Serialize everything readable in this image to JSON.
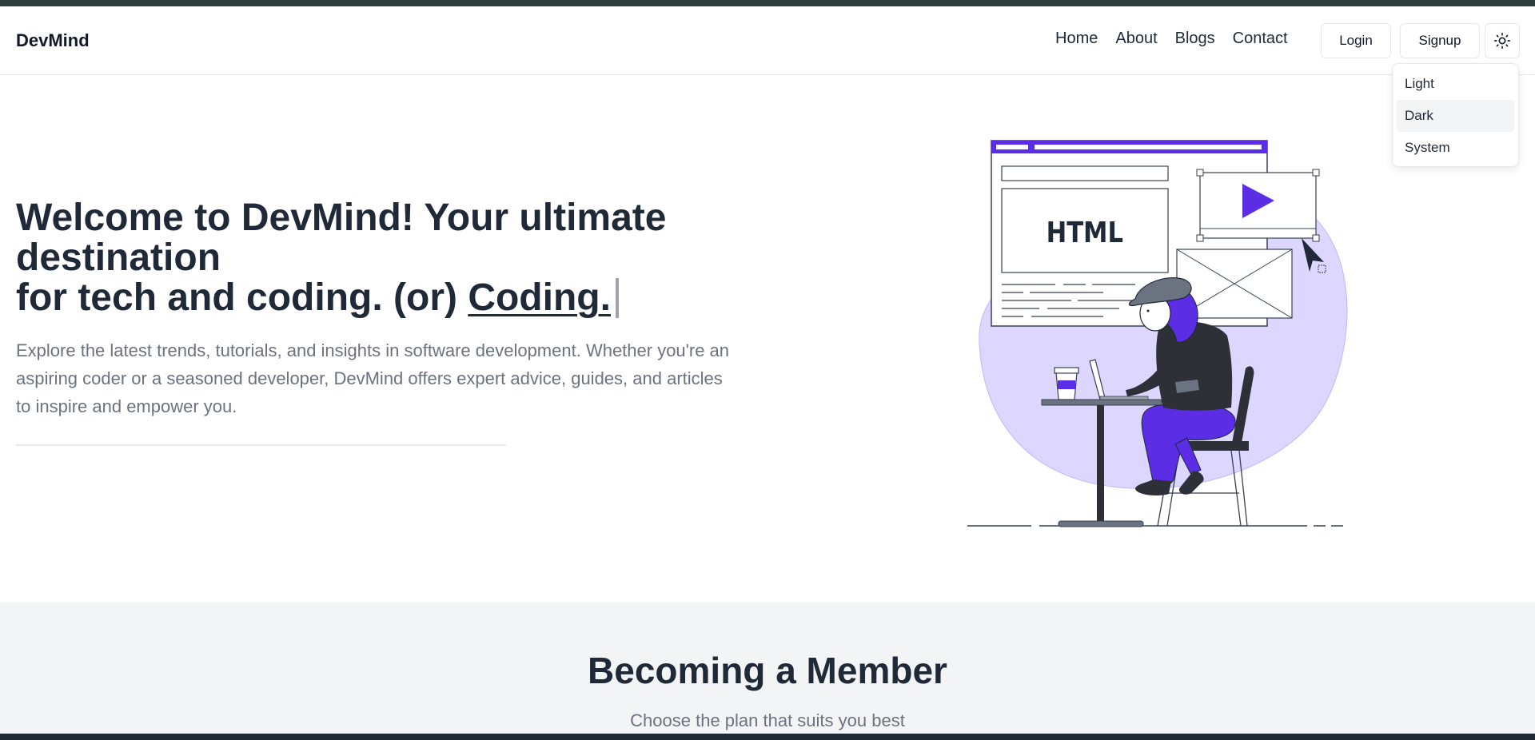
{
  "header": {
    "brand": "DevMind",
    "nav": [
      "Home",
      "About",
      "Blogs",
      "Contact"
    ],
    "login_label": "Login",
    "signup_label": "Signup",
    "theme_icon": "sun-icon"
  },
  "theme_menu": {
    "items": [
      "Light",
      "Dark",
      "System"
    ],
    "highlighted": "Dark"
  },
  "hero": {
    "title_bold": "Welcome to DevMind!",
    "title_rest": " Your ultimate destination",
    "title_line2": "for tech and coding. (or) ",
    "typed_word": "Coding.",
    "subtitle": "Explore the latest trends, tutorials, and insights in software development. Whether you're an aspiring coder or a seasoned developer, DevMind offers expert advice, guides, and articles to inspire and empower you.",
    "illustration_text": "HTML"
  },
  "member": {
    "heading": "Becoming a Member",
    "subheading": "Choose the plan that suits you best"
  },
  "colors": {
    "accent": "#5b2ee6",
    "blob": "#ddd6fe",
    "text": "#1f2937",
    "muted": "#6b7280"
  }
}
